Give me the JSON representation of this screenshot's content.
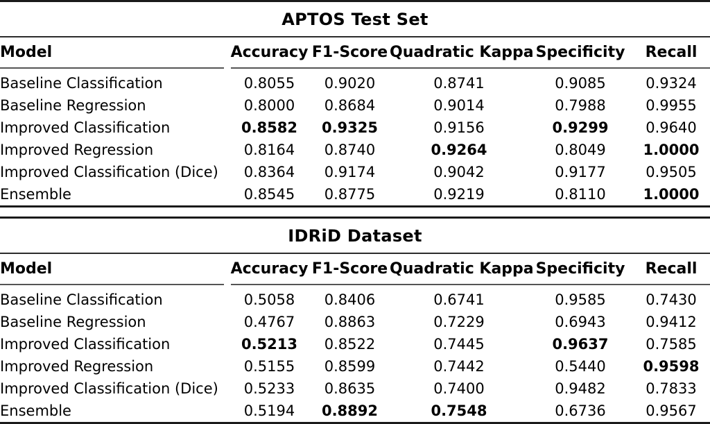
{
  "tables": [
    {
      "title": "APTOS Test Set",
      "columns": [
        "Model",
        "Accuracy",
        "F1-Score",
        "Quadratic Kappa",
        "Specificity",
        "Recall"
      ],
      "rows": [
        {
          "model": "Baseline Classification",
          "values": [
            "0.8055",
            "0.9020",
            "0.8741",
            "0.9085",
            "0.9324"
          ],
          "bold": [
            false,
            false,
            false,
            false,
            false
          ]
        },
        {
          "model": "Baseline Regression",
          "values": [
            "0.8000",
            "0.8684",
            "0.9014",
            "0.7988",
            "0.9955"
          ],
          "bold": [
            false,
            false,
            false,
            false,
            false
          ]
        },
        {
          "model": "Improved Classification",
          "values": [
            "0.8582",
            "0.9325",
            "0.9156",
            "0.9299",
            "0.9640"
          ],
          "bold": [
            true,
            true,
            false,
            true,
            false
          ]
        },
        {
          "model": "Improved Regression",
          "values": [
            "0.8164",
            "0.8740",
            "0.9264",
            "0.8049",
            "1.0000"
          ],
          "bold": [
            false,
            false,
            true,
            false,
            true
          ]
        },
        {
          "model": "Improved Classification (Dice)",
          "values": [
            "0.8364",
            "0.9174",
            "0.9042",
            "0.9177",
            "0.9505"
          ],
          "bold": [
            false,
            false,
            false,
            false,
            false
          ]
        },
        {
          "model": "Ensemble",
          "values": [
            "0.8545",
            "0.8775",
            "0.9219",
            "0.8110",
            "1.0000"
          ],
          "bold": [
            false,
            false,
            false,
            false,
            true
          ]
        }
      ]
    },
    {
      "title": "IDRiD Dataset",
      "columns": [
        "Model",
        "Accuracy",
        "F1-Score",
        "Quadratic Kappa",
        "Specificity",
        "Recall"
      ],
      "rows": [
        {
          "model": "Baseline Classification",
          "values": [
            "0.5058",
            "0.8406",
            "0.6741",
            "0.9585",
            "0.7430"
          ],
          "bold": [
            false,
            false,
            false,
            false,
            false
          ]
        },
        {
          "model": "Baseline Regression",
          "values": [
            "0.4767",
            "0.8863",
            "0.7229",
            "0.6943",
            "0.9412"
          ],
          "bold": [
            false,
            false,
            false,
            false,
            false
          ]
        },
        {
          "model": "Improved Classification",
          "values": [
            "0.5213",
            "0.8522",
            "0.7445",
            "0.9637",
            "0.7585"
          ],
          "bold": [
            true,
            false,
            false,
            true,
            false
          ]
        },
        {
          "model": "Improved Regression",
          "values": [
            "0.5155",
            "0.8599",
            "0.7442",
            "0.5440",
            "0.9598"
          ],
          "bold": [
            false,
            false,
            false,
            false,
            true
          ]
        },
        {
          "model": "Improved Classification (Dice)",
          "values": [
            "0.5233",
            "0.8635",
            "0.7400",
            "0.9482",
            "0.7833"
          ],
          "bold": [
            false,
            false,
            false,
            false,
            false
          ]
        },
        {
          "model": "Ensemble",
          "values": [
            "0.5194",
            "0.8892",
            "0.7548",
            "0.6736",
            "0.9567"
          ],
          "bold": [
            false,
            true,
            true,
            false,
            false
          ]
        }
      ]
    }
  ],
  "colors": {
    "text": "#000000",
    "rule_heavy": "#1a1a1a",
    "rule_light": "#555555",
    "background": "#ffffff"
  }
}
